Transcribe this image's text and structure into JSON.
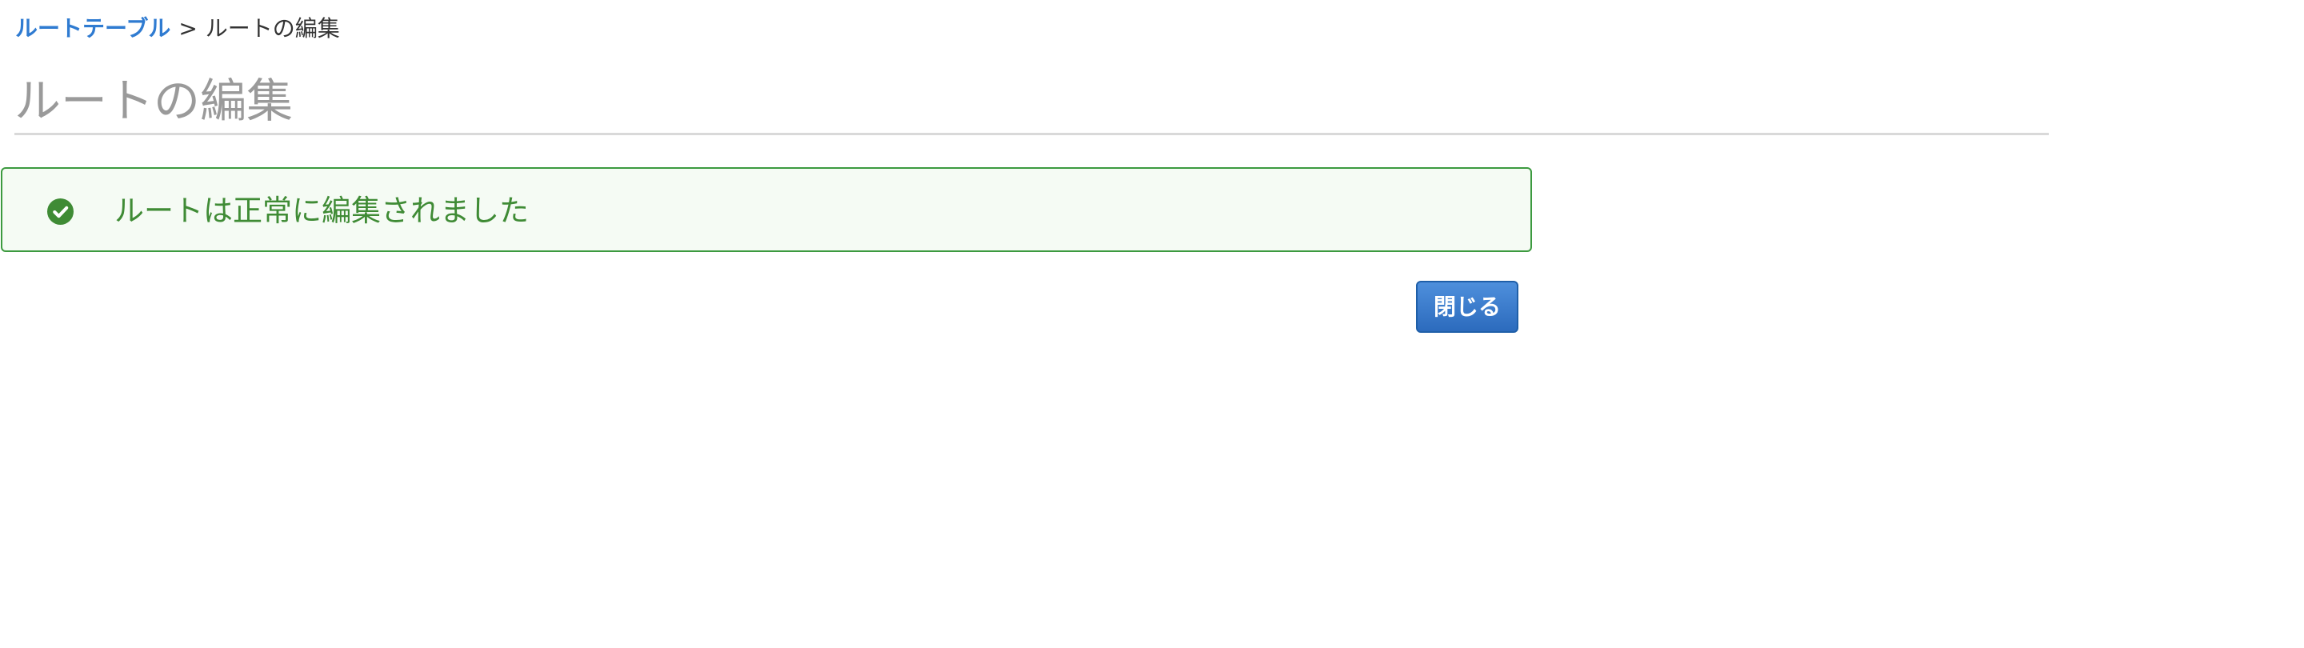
{
  "breadcrumb": {
    "parent_label": "ルートテーブル",
    "separator": ">",
    "current_label": "ルートの編集"
  },
  "page": {
    "title": "ルートの編集"
  },
  "alert": {
    "status": "success",
    "icon": "check-circle-icon",
    "message": "ルートは正常に編集されました",
    "border_color": "#3c9a3f",
    "text_color": "#3f8b35"
  },
  "actions": {
    "close_label": "閉じる",
    "accent_color": "#2f7bd1"
  }
}
